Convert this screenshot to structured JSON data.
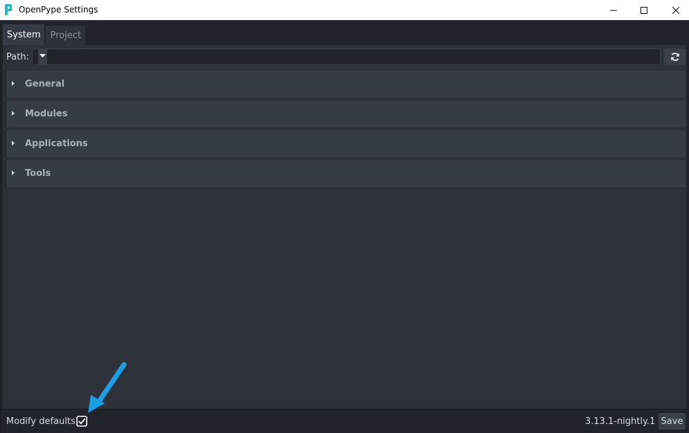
{
  "window": {
    "title": "OpenPype Settings"
  },
  "tabs": [
    {
      "label": "System",
      "active": true
    },
    {
      "label": "Project",
      "active": false
    }
  ],
  "path": {
    "label": "Path:",
    "value": ""
  },
  "sections": [
    {
      "label": "General"
    },
    {
      "label": "Modules"
    },
    {
      "label": "Applications"
    },
    {
      "label": "Tools"
    }
  ],
  "footer": {
    "modify_defaults_label": "Modify defaults",
    "modify_defaults_checked": true,
    "version": "3.13.1-nightly.1",
    "save_label": "Save"
  },
  "colors": {
    "app_background": "#21252b",
    "panel_background": "#2c313a",
    "section_background": "#363c46",
    "annotation_arrow": "#1a9fe6",
    "logo_teal": "#1fb7c6"
  },
  "icons": {
    "app": "openpype-logo-icon",
    "minimize": "minimize-icon",
    "maximize": "maximize-icon",
    "close": "close-icon",
    "dropdown": "chevron-down-icon",
    "refresh": "refresh-icon",
    "section_caret": "caret-right-icon",
    "checkbox": "checkbox-checked-icon",
    "annotation": "arrow-annotation-icon"
  }
}
